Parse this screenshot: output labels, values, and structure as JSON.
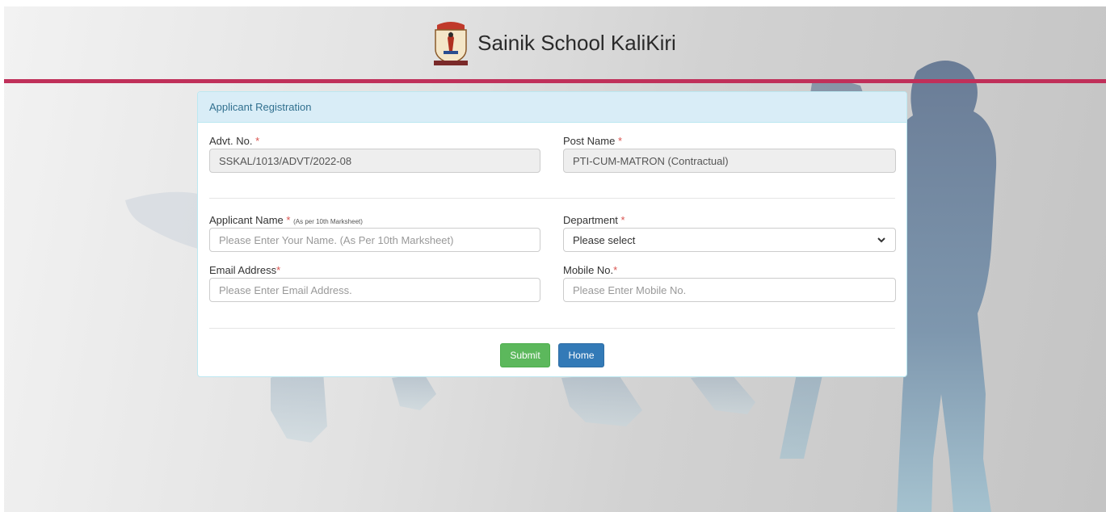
{
  "site": {
    "title": "Sainik School KaliKiri"
  },
  "colors": {
    "accent": "#c0305a",
    "panel_heading_bg": "#d9edf7",
    "panel_heading_text": "#31708f",
    "success": "#5cb85c",
    "primary": "#337ab7",
    "required": "#d9534f"
  },
  "panel": {
    "title": "Applicant Registration"
  },
  "form": {
    "advt_no": {
      "label": "Advt. No.",
      "required_mark": "*",
      "value": "SSKAL/1013/ADVT/2022-08"
    },
    "post_name": {
      "label": "Post Name",
      "required_mark": "*",
      "value": "PTI-CUM-MATRON (Contractual)"
    },
    "applicant_name": {
      "label": "Applicant Name",
      "required_mark": "*",
      "note": "(As per 10th Marksheet)",
      "placeholder": "Please Enter Your Name. (As Per 10th Marksheet)",
      "value": ""
    },
    "department": {
      "label": "Department",
      "required_mark": "*",
      "selected": "Please select"
    },
    "email": {
      "label": "Email Address",
      "required_mark": "*",
      "placeholder": "Please Enter Email Address.",
      "value": ""
    },
    "mobile": {
      "label": "Mobile No.",
      "required_mark": "*",
      "placeholder": "Please Enter Mobile No.",
      "value": ""
    }
  },
  "buttons": {
    "submit": "Submit",
    "home": "Home"
  },
  "icons": {
    "logo": "school-crest-icon",
    "dropdown": "chevron-down-icon"
  }
}
